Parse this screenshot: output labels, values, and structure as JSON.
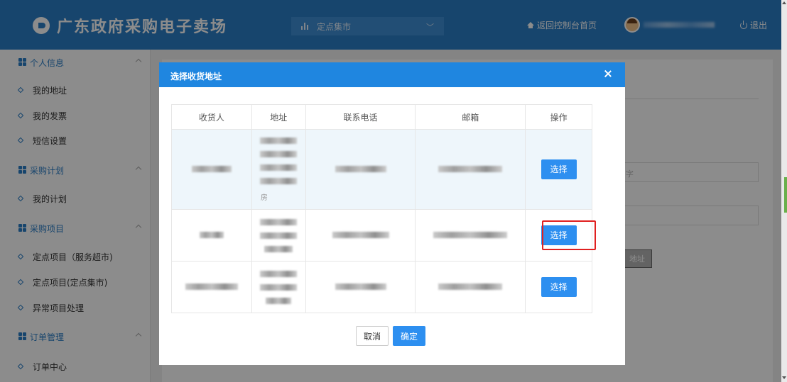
{
  "header": {
    "title": "广东政府采购电子卖场",
    "market_select": "定点集市",
    "home_link": "返回控制台首页",
    "logout": "退出"
  },
  "sidebar": {
    "groups": [
      {
        "label": "个人信息",
        "items": [
          "我的地址",
          "我的发票",
          "短信设置"
        ]
      },
      {
        "label": "采购计划",
        "items": [
          "我的计划"
        ]
      },
      {
        "label": "采购项目",
        "items": [
          "定点项目（服务超市)",
          "定点项目(定点集市)",
          "异常项目处理"
        ]
      },
      {
        "label": "订单管理",
        "items": [
          "订单中心"
        ]
      }
    ]
  },
  "background": {
    "input_hint": "字",
    "button_label": "地址"
  },
  "modal": {
    "title": "选择收货地址",
    "columns": [
      "收货人",
      "地址",
      "联系电话",
      "邮箱",
      "操作"
    ],
    "rows": [
      {
        "action": "选择",
        "address_tail": "房"
      },
      {
        "action": "选择"
      },
      {
        "action": "选择"
      }
    ],
    "cancel": "取消",
    "confirm": "确定"
  },
  "colors": {
    "header": "#2b7ec7",
    "modal_header": "#1f86e0",
    "primary_button": "#2d8ff0",
    "highlight_border": "#e02020"
  }
}
